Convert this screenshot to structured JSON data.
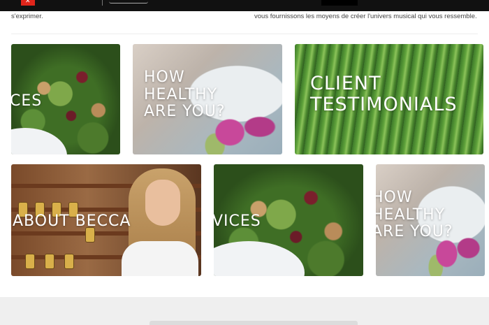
{
  "header": {
    "logo_icon": "brand-logo-icon",
    "signature": "signature-logo"
  },
  "intro": {
    "left_text": "s'exprimer.",
    "right_text": "vous fournissons les moyens de créer l'univers musical qui vous ressemble."
  },
  "tiles": [
    {
      "id": "services-1",
      "label": "CES",
      "image": "salad"
    },
    {
      "id": "healthy-1",
      "label": "HOW\nHEALTHY\nARE YOU?",
      "image": "flowers-bowl"
    },
    {
      "id": "testimonials",
      "label": "CLIENT\nTESTIMONIALS",
      "image": "asparagus"
    },
    {
      "id": "about",
      "label": "ABOUT BECCA",
      "image": "portrait"
    },
    {
      "id": "services-2",
      "label": "VICES",
      "image": "salad"
    },
    {
      "id": "healthy-2",
      "label": "HOW\nHEALTHY\nARE YOU?",
      "image": "flowers-bowl"
    }
  ],
  "colors": {
    "topbar": "#111111",
    "brand_red": "#e0251b",
    "footer": "#efefef",
    "tile_text": "#ffffff"
  }
}
